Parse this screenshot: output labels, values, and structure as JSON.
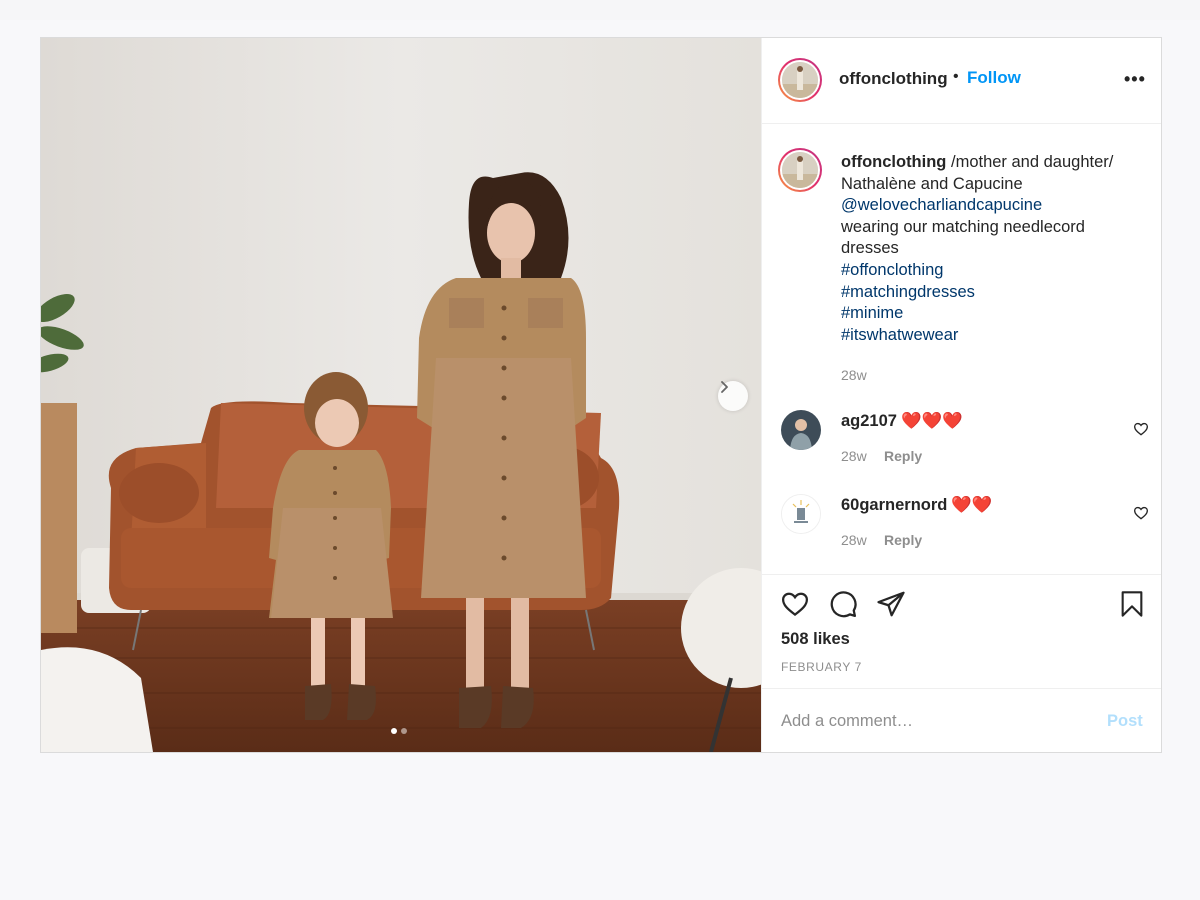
{
  "post": {
    "username": "offonclothing",
    "follow_label": "Follow",
    "separator": "•",
    "more_label": "•••"
  },
  "caption": {
    "username": "offonclothing",
    "text_line1": "/mother and daughter/",
    "text_line2": "Nathalène and Capucine",
    "mention": "@welovecharliandcapucine",
    "text_line3": "wearing our matching needlecord dresses",
    "hashtags": [
      "#offonclothing",
      "#matchingdresses",
      "#minime",
      "#itswhatwewear"
    ],
    "time": "28w"
  },
  "comments": [
    {
      "username": "ag2107",
      "hearts": "❤️❤️❤️",
      "time": "28w",
      "reply_label": "Reply"
    },
    {
      "username": "60garnernord",
      "hearts": "❤️❤️",
      "time": "28w",
      "reply_label": "Reply"
    }
  ],
  "engagement": {
    "likes": "508 likes",
    "date": "FEBRUARY 7"
  },
  "add_comment": {
    "placeholder": "Add a comment…",
    "post_label": "Post"
  },
  "carousel": {
    "current": 1,
    "total": 2
  },
  "colors": {
    "link_blue": "#0095f6",
    "hashtag_navy": "#00376b",
    "post_disabled": "#b2dffc",
    "heart_red": "#e0245e"
  }
}
